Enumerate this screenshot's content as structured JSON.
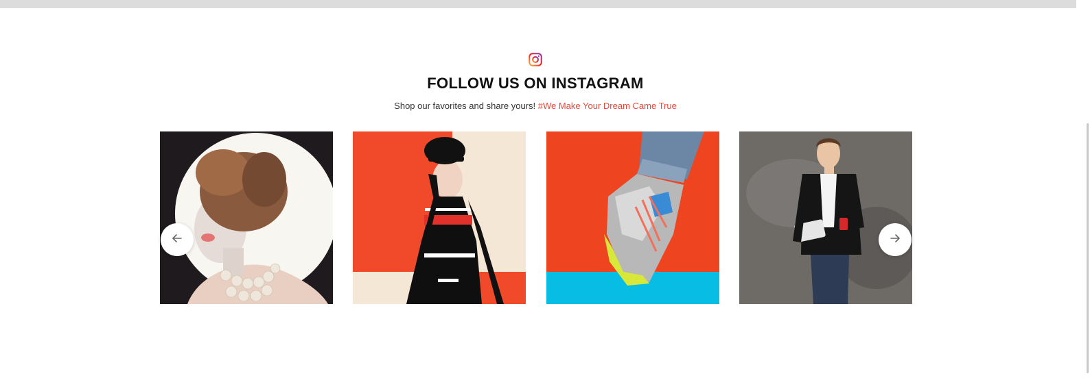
{
  "section": {
    "icon": "instagram-icon",
    "title": "FOLLOW US ON INSTAGRAM",
    "subtitle_text": "Shop our favorites and share yours!",
    "subtitle_hashtag": "#We Make Your Dream Came True"
  },
  "gallery": {
    "images": [
      {
        "name": "woman-curly-hair-pearls"
      },
      {
        "name": "woman-black-hat-dress"
      },
      {
        "name": "silver-sneaker"
      },
      {
        "name": "man-blazer-coffee"
      }
    ],
    "prev_icon": "arrow-left-icon",
    "next_icon": "arrow-right-icon"
  },
  "colors": {
    "accent": "#e8493a",
    "title": "#111111",
    "instagram_gradient": [
      "#833ab4",
      "#fd1d1d",
      "#fcb045"
    ]
  }
}
